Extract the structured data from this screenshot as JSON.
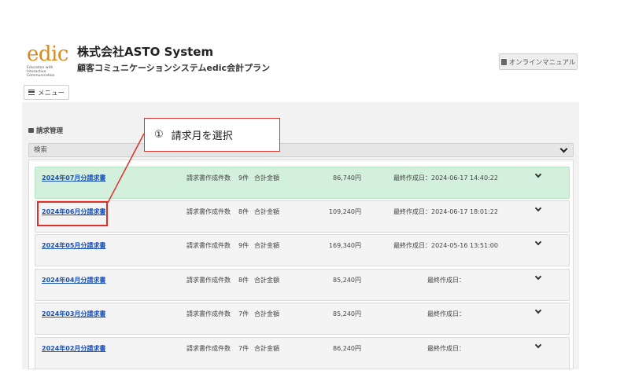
{
  "header": {
    "logo_text": "edic",
    "logo_subtext": "Education with Interactive Communication",
    "company_name": "株式会社ASTO System",
    "plan_name": "顧客コミュニケーションシステムedic会計プラン",
    "manual_button": "オンラインマニュアル",
    "menu_button": "メニュー"
  },
  "section": {
    "title": "請求管理",
    "search_label": "検索"
  },
  "callout": {
    "number": "①",
    "text": "請求月を選択"
  },
  "colors": {
    "active_row": "#d3f0dc",
    "link": "#1a4fb4",
    "annotation": "#e0302a",
    "logo": "#d98a1e"
  },
  "invoices": [
    {
      "month": "2024年07月分請求書",
      "count_label": "請求書作成件数",
      "count": "9件",
      "total_label": "合計金額",
      "amount": "86,740円",
      "date": "最終作成日：2024-06-17 14:40:22",
      "active": true
    },
    {
      "month": "2024年06月分請求書",
      "count_label": "請求書作成件数",
      "count": "8件",
      "total_label": "合計金額",
      "amount": "109,240円",
      "date": "最終作成日：2024-06-17 18:01:22",
      "active": false
    },
    {
      "month": "2024年05月分請求書",
      "count_label": "請求書作成件数",
      "count": "9件",
      "total_label": "合計金額",
      "amount": "169,340円",
      "date": "最終作成日：2024-05-16 13:51:00",
      "active": false
    },
    {
      "month": "2024年04月分請求書",
      "count_label": "請求書作成件数",
      "count": "8件",
      "total_label": "合計金額",
      "amount": "85,240円",
      "date": "最終作成日：",
      "active": false
    },
    {
      "month": "2024年03月分請求書",
      "count_label": "請求書作成件数",
      "count": "7件",
      "total_label": "合計金額",
      "amount": "85,240円",
      "date": "最終作成日：",
      "active": false
    },
    {
      "month": "2024年02月分請求書",
      "count_label": "請求書作成件数",
      "count": "7件",
      "total_label": "合計金額",
      "amount": "86,240円",
      "date": "最終作成日：",
      "active": false
    }
  ]
}
